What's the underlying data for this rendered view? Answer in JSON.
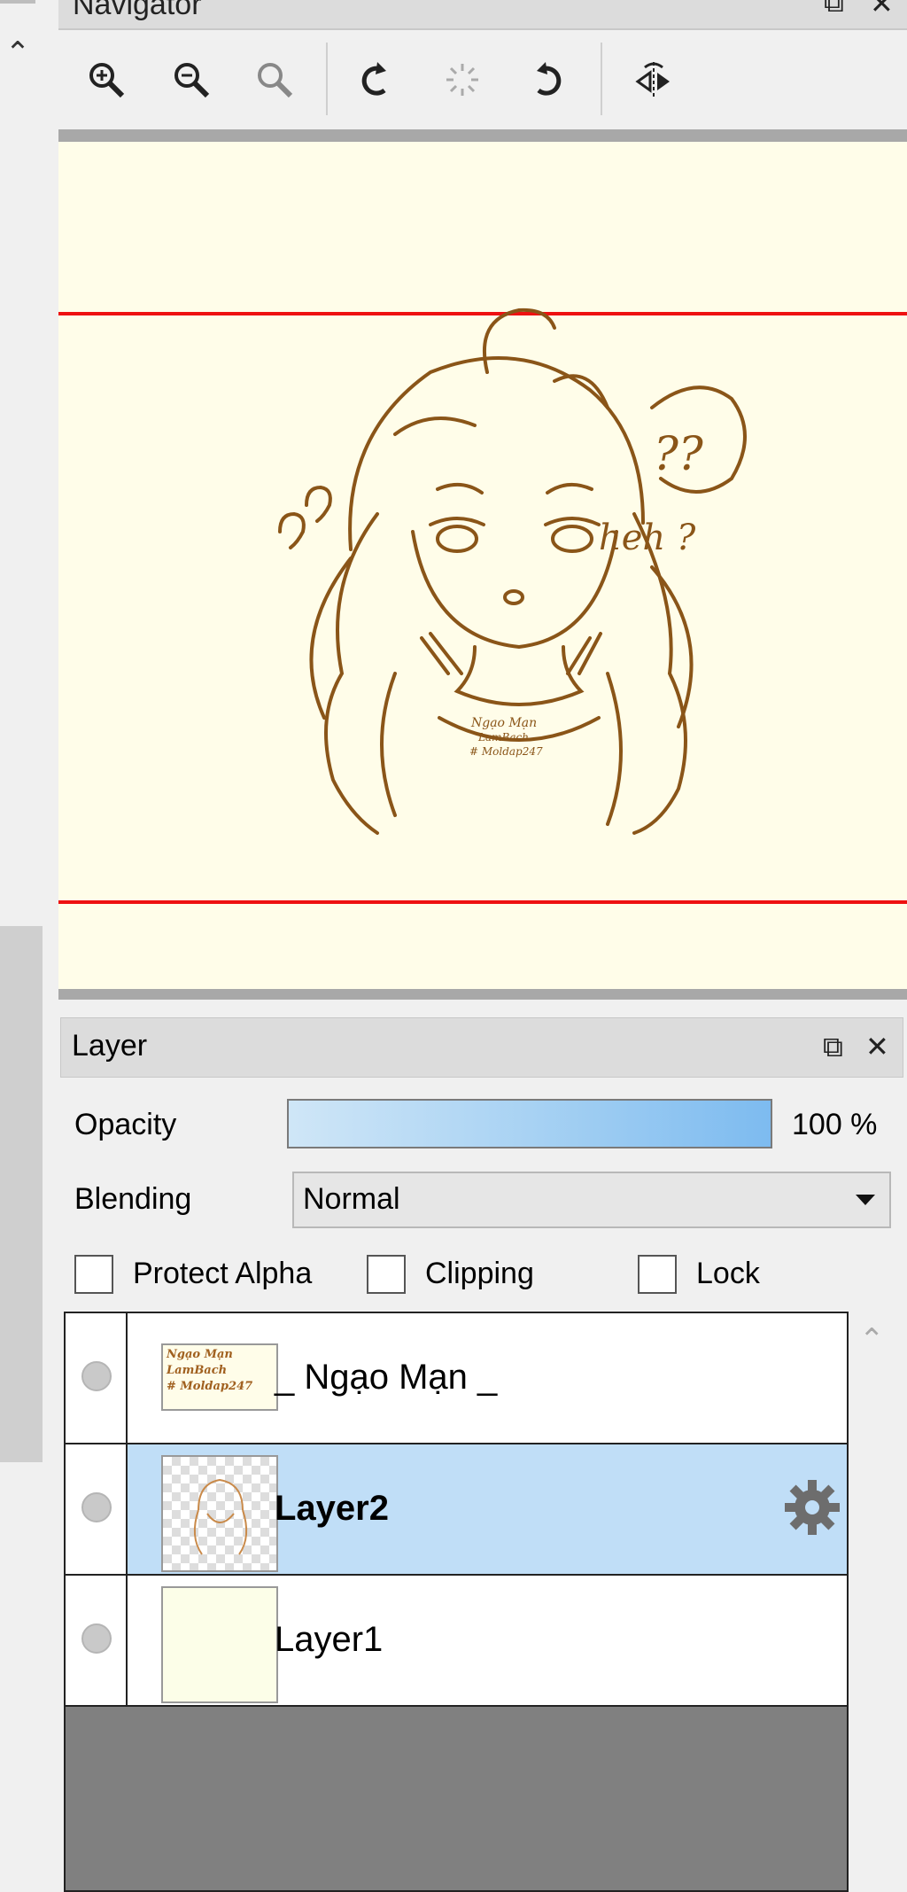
{
  "navigator": {
    "title": "Navigator",
    "tools": [
      "zoom-in",
      "zoom-out",
      "zoom-reset",
      "rotate-left",
      "rotate-reset",
      "rotate-right",
      "flip-horizontal"
    ]
  },
  "canvas": {
    "question_left": "??",
    "bubble_text": "??",
    "heh_text": "heh ?",
    "shirt_text_1": "Ngạo Mạn",
    "shirt_text_2": "LamBach",
    "shirt_text_3": "# Moldap247"
  },
  "layer_panel": {
    "title": "Layer",
    "opacity_label": "Opacity",
    "opacity_value": "100 %",
    "opacity_fraction": 1.0,
    "blending_label": "Blending",
    "blending_value": "Normal",
    "protect_alpha_label": "Protect Alpha",
    "clipping_label": "Clipping",
    "lock_label": "Lock",
    "layers": [
      {
        "name": "_ Ngạo Mạn _",
        "thumb_lines": [
          "Ngạo Mạn",
          "LamBach",
          "# Moldap247"
        ]
      },
      {
        "name": "Layer2",
        "selected": true
      },
      {
        "name": "Layer1"
      }
    ]
  },
  "colors": {
    "canvas_bg": "#fffde9",
    "guide_red": "#e11111",
    "ink": "#8a5518",
    "selection": "#c0def7"
  }
}
